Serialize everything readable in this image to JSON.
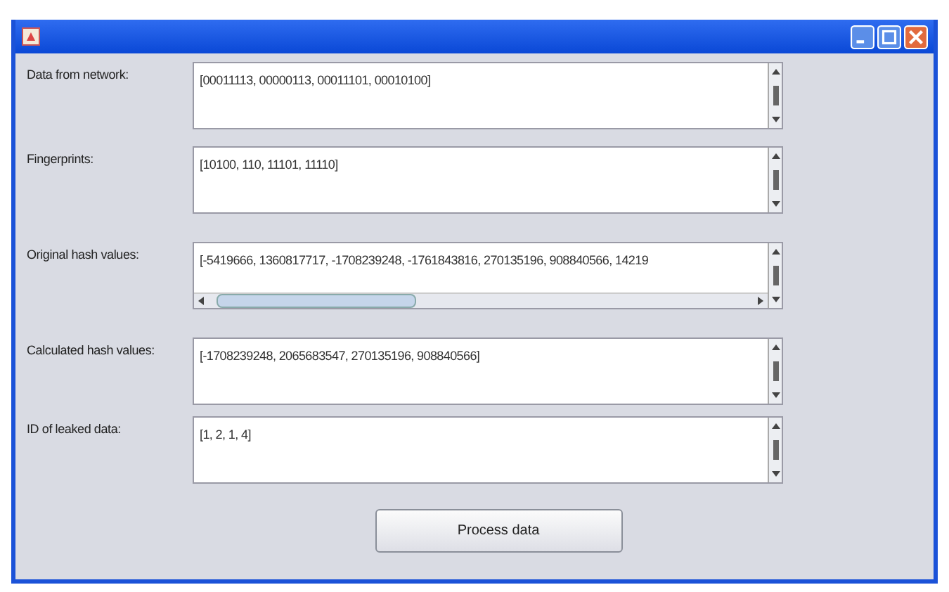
{
  "rows": [
    {
      "label": "Data from network:",
      "value": "[00011113, 00000113, 00011101, 00010100]",
      "hscroll": false
    },
    {
      "label": "Fingerprints:",
      "value": "[10100, 110, 11101, 11110]",
      "hscroll": false
    },
    {
      "label": "Original hash values:",
      "value": "[-5419666, 1360817717, -1708239248, -1761843816, 270135196, 908840566, 14219",
      "hscroll": true
    },
    {
      "label": "Calculated hash values:",
      "value": "[-1708239248, 2065683547, 270135196, 908840566]",
      "hscroll": false
    },
    {
      "label": "ID of leaked data:",
      "value": "[1, 2, 1, 4]",
      "hscroll": false
    }
  ],
  "button": "Process data"
}
